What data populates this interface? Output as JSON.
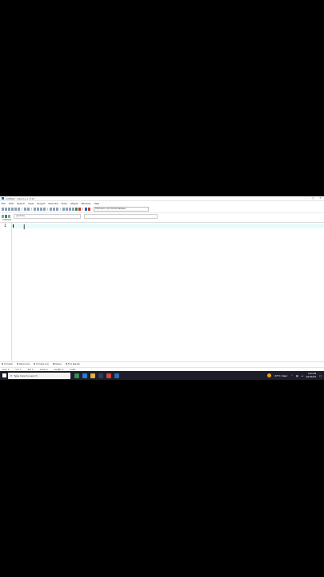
{
  "window": {
    "title": "untitled - Dev-C++ 5.11",
    "min_label": "–",
    "max_label": "□",
    "close_label": "✕"
  },
  "menu": [
    "File",
    "Edit",
    "Search",
    "View",
    "Project",
    "Execute",
    "Tools",
    "AStyle",
    "Window",
    "Help"
  ],
  "toolbar": {
    "compiler_label": "TDM-GCC 4.9.2 64-bit Release"
  },
  "toolbar2": {
    "globals_label": "(globals)",
    "scope_label": ""
  },
  "tabs": {
    "active": "Untitled1"
  },
  "editor": {
    "line_number": "1",
    "cursor_glyph": "I"
  },
  "bottom_tabs": [
    "Compiler",
    "Resources",
    "Compile Log",
    "Debug",
    "Find Results"
  ],
  "status": {
    "line_label": "Line:",
    "line_value": "1",
    "col_label": "Col:",
    "col_value": "1",
    "sel_label": "Sel:",
    "sel_value": "0",
    "lines_label": "Lines:",
    "lines_value": "0",
    "length_label": "Length:",
    "length_value": "0",
    "mode": "Insert"
  },
  "taskbar": {
    "search_placeholder": "Type here to search",
    "weather": "23°C Clear",
    "time": "6:25 PM",
    "date": "4/23/2022"
  },
  "colors": {
    "current_line": "#e8fbfb",
    "taskbar": "#1e1e2a"
  }
}
